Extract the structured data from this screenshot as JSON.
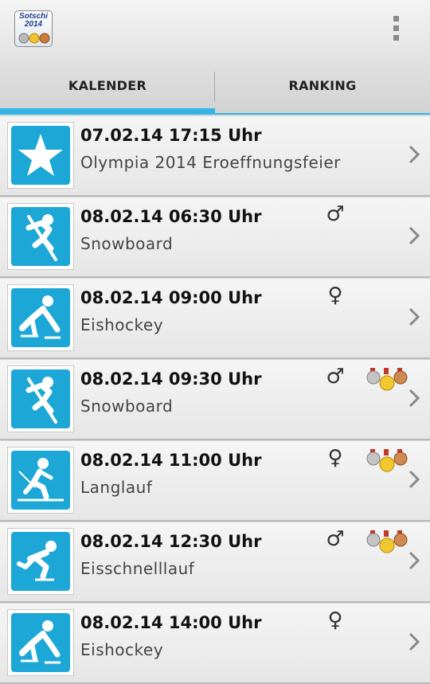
{
  "app": {
    "icon_title": "Sotschi",
    "icon_year": "2014"
  },
  "tabs": [
    {
      "label": "KALENDER",
      "selected": true
    },
    {
      "label": "RANKING",
      "selected": false
    }
  ],
  "accent_color": "#33b5e5",
  "events": [
    {
      "datetime": "07.02.14 17:15 Uhr",
      "name": "Olympia 2014 Eroeffnungsfeier",
      "icon": "star-icon",
      "gender": "",
      "medals": false
    },
    {
      "datetime": "08.02.14 06:30 Uhr",
      "name": "Snowboard",
      "icon": "snowboard-icon",
      "gender": "♂",
      "medals": false
    },
    {
      "datetime": "08.02.14 09:00 Uhr",
      "name": "Eishockey",
      "icon": "ice-hockey-icon",
      "gender": "♀",
      "medals": false
    },
    {
      "datetime": "08.02.14 09:30 Uhr",
      "name": "Snowboard",
      "icon": "snowboard-icon",
      "gender": "♂",
      "medals": true
    },
    {
      "datetime": "08.02.14 11:00 Uhr",
      "name": "Langlauf",
      "icon": "cross-country-skiing-icon",
      "gender": "♀",
      "medals": true
    },
    {
      "datetime": "08.02.14 12:30 Uhr",
      "name": "Eisschnelllauf",
      "icon": "speed-skating-icon",
      "gender": "♂",
      "medals": true
    },
    {
      "datetime": "08.02.14 14:00 Uhr",
      "name": "Eishockey",
      "icon": "ice-hockey-icon",
      "gender": "♀",
      "medals": false
    }
  ]
}
